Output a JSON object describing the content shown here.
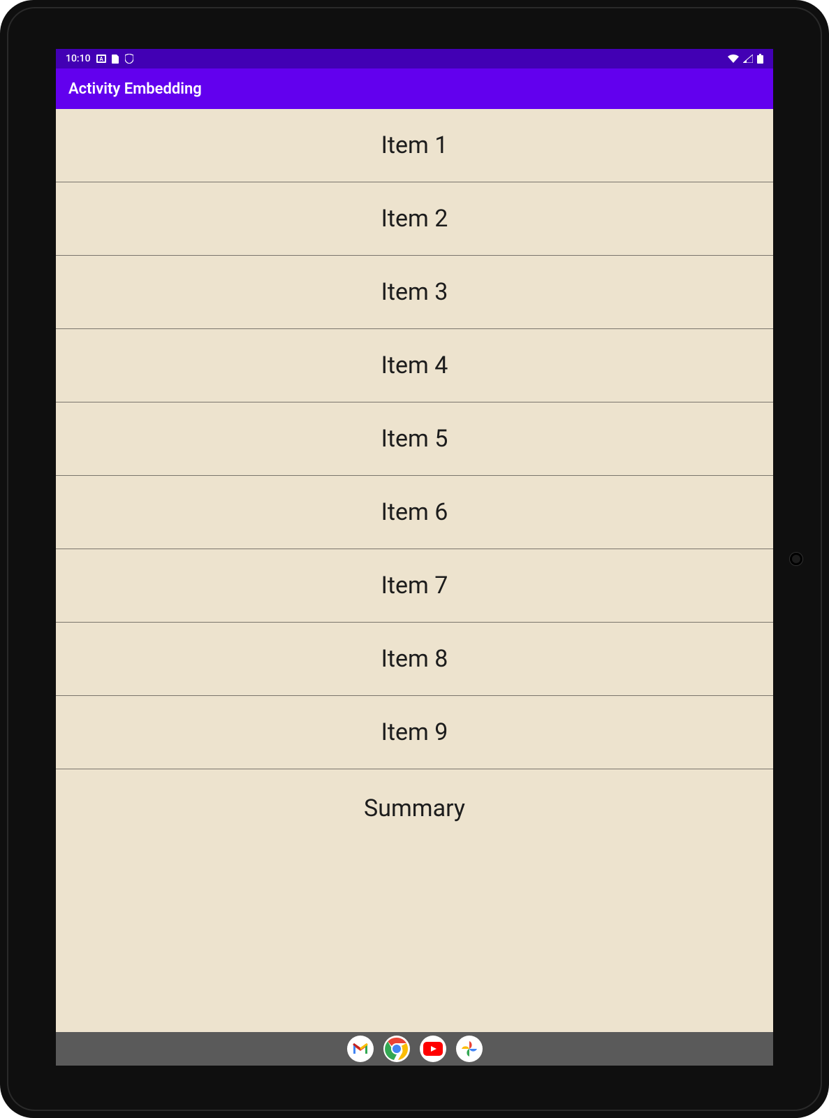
{
  "statusbar": {
    "time": "10:10",
    "icons_left": [
      "keyboard-icon",
      "document-icon",
      "shield-icon"
    ],
    "icons_right": [
      "wifi-icon",
      "cell-signal-icon",
      "battery-icon"
    ]
  },
  "appbar": {
    "title": "Activity Embedding"
  },
  "list": {
    "items": [
      {
        "label": "Item 1"
      },
      {
        "label": "Item 2"
      },
      {
        "label": "Item 3"
      },
      {
        "label": "Item 4"
      },
      {
        "label": "Item 5"
      },
      {
        "label": "Item 6"
      },
      {
        "label": "Item 7"
      },
      {
        "label": "Item 8"
      },
      {
        "label": "Item 9"
      },
      {
        "label": "Summary"
      }
    ]
  },
  "navbar": {
    "apps": [
      "gmail-icon",
      "chrome-icon",
      "youtube-icon",
      "photos-icon"
    ]
  },
  "colors": {
    "status_bar": "#4200b4",
    "app_bar": "#6200ee",
    "list_bg": "#ede3ce",
    "divider": "#7a756c",
    "nav_bar": "#5a5a5a"
  }
}
